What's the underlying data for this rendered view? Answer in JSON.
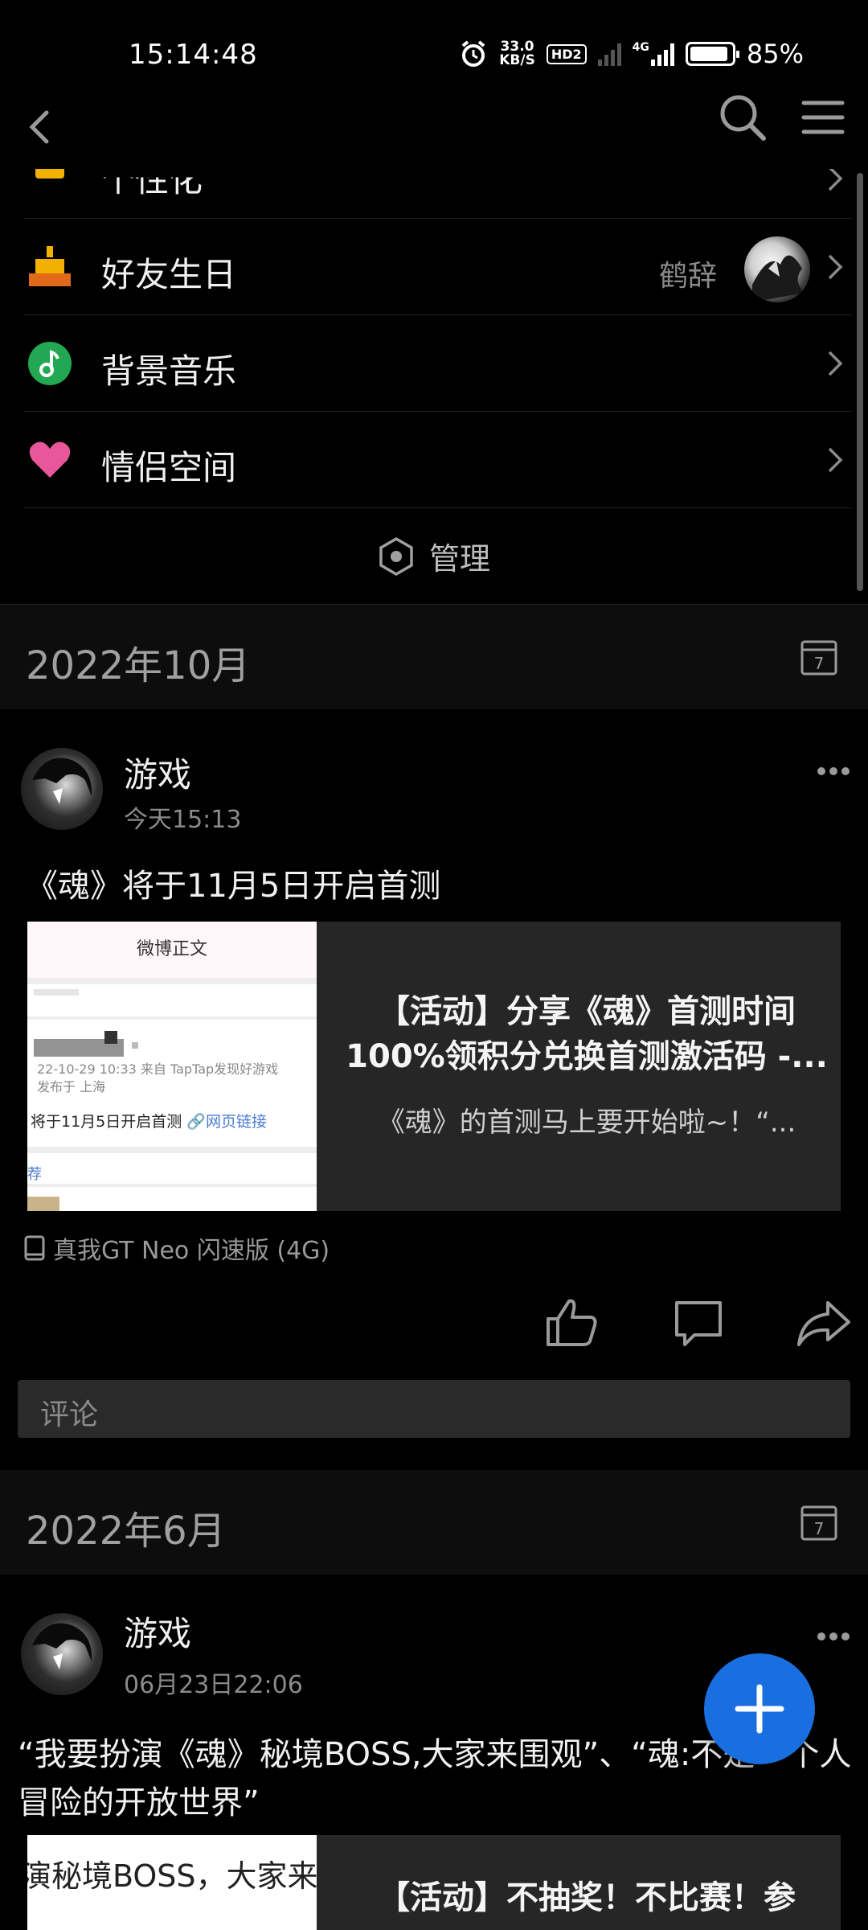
{
  "status_bar": {
    "time": "15:14:48",
    "net_speed_value": "33.0",
    "net_speed_unit": "KB/S",
    "hd_badge": "HD2",
    "network_type": "4G",
    "battery": "85%"
  },
  "menu_rows": [
    {
      "label": "个性化",
      "value": ""
    },
    {
      "label": "好友生日",
      "value": "鹤辞"
    },
    {
      "label": "背景音乐",
      "value": ""
    },
    {
      "label": "情侣空间",
      "value": ""
    }
  ],
  "manage_label": "管理",
  "sections": [
    {
      "month": "2022年10月",
      "calendar_day": "7",
      "post": {
        "author": "游戏",
        "time": "今天15:13",
        "text": "《魂》将于11月5日开启首测",
        "link_title_1": "【活动】分享《魂》首测时间",
        "link_title_2": "100%领积分兑换首测激活码 -...",
        "link_desc": "《魂》的首测马上要开始啦~！“...",
        "thumb": {
          "header": "微博正文",
          "meta1": "22-10-29 10:33  来自 TapTap发现好游戏",
          "meta2": "发布于 上海",
          "body": "将于11月5日开启首测",
          "link_text": "🔗网页链接",
          "footer": "荐"
        },
        "device": "真我GT Neo 闪速版 (4G)",
        "comment_placeholder": "评论"
      }
    },
    {
      "month": "2022年6月",
      "calendar_day": "7",
      "post": {
        "author": "游戏",
        "time": "06月23日22:06",
        "text": "“我要扮演《魂》秘境BOSS,大家来围观”、“魂:不是一个人冒险的开放世界”",
        "link_title_1": "【活动】不抽奖！不比赛！参",
        "thumb_text": "演秘境BOSS，大家来"
      }
    }
  ],
  "colors": {
    "fab": "#1a6fe0",
    "background": "#000000",
    "month_header_bg": "#0d0d0d"
  },
  "icons": [
    "back-icon",
    "search-icon",
    "menu-icon",
    "gift-icon",
    "cake-icon",
    "music-icon",
    "heart-icon",
    "hexagon-icon",
    "calendar-icon",
    "more-icon",
    "phone-icon",
    "like-icon",
    "comment-icon",
    "share-icon",
    "plus-icon"
  ]
}
